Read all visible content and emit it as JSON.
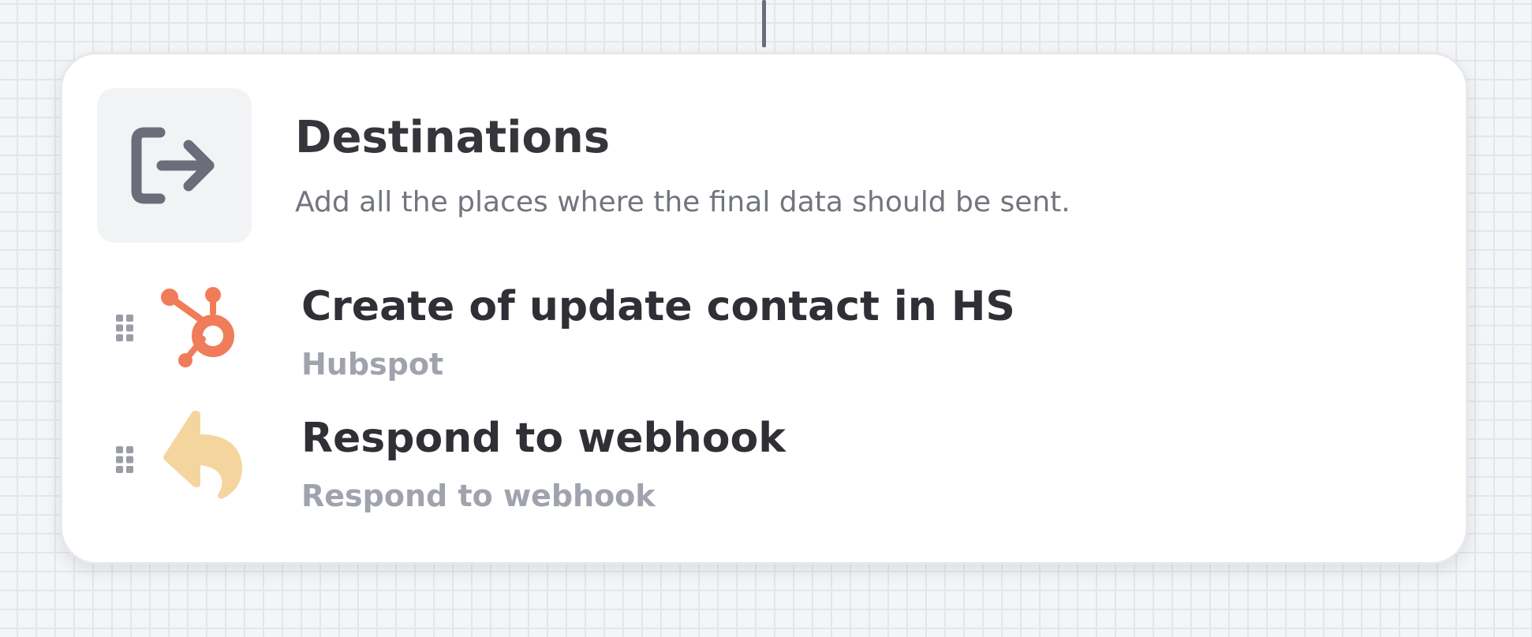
{
  "header": {
    "title": "Destinations",
    "subtitle": "Add all the places where the final data should be sent.",
    "icon": "exit-arrow-icon"
  },
  "destinations": [
    {
      "title": "Create of update contact in HS",
      "subtitle": "Hubspot",
      "icon": "hubspot-icon",
      "icon_color": "#f07c59"
    },
    {
      "title": "Respond to webhook",
      "subtitle": "Respond to webhook",
      "icon": "reply-arrow-icon",
      "icon_color": "#f5d59e"
    }
  ],
  "colors": {
    "canvas_background": "#f3f5f7",
    "grid_lines": "#e3e6ea",
    "card_background": "#ffffff",
    "title_text": "#35363b",
    "muted_text": "#a0a3ad",
    "icon_gray": "#6b6e7a"
  }
}
